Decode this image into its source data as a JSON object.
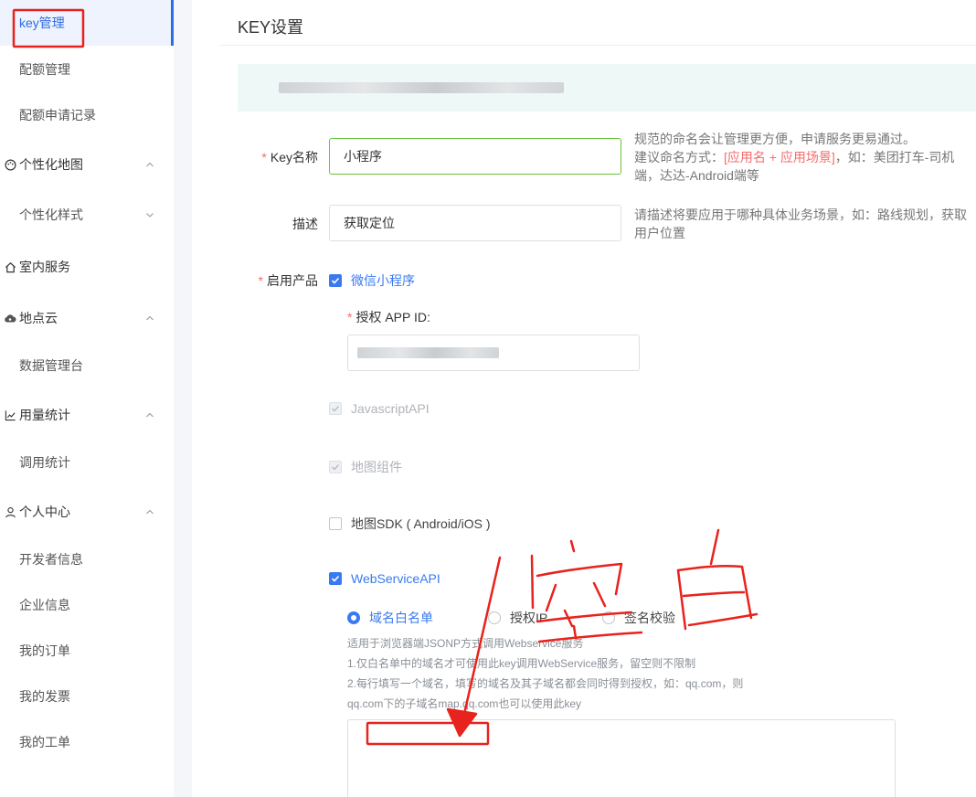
{
  "sidebar": {
    "items": [
      {
        "label": "key管理",
        "icon": "",
        "type": "sub",
        "active": true
      },
      {
        "label": "配额管理",
        "icon": "",
        "type": "sub"
      },
      {
        "label": "配额申请记录",
        "icon": "",
        "type": "sub"
      },
      {
        "label": "个性化地图",
        "icon": "palette-icon",
        "type": "group",
        "chevron": "up"
      },
      {
        "label": "个性化样式",
        "icon": "",
        "type": "sub",
        "chevron": "down"
      },
      {
        "label": "室内服务",
        "icon": "home-icon",
        "type": "group"
      },
      {
        "label": "地点云",
        "icon": "cloud-icon",
        "type": "group",
        "chevron": "up"
      },
      {
        "label": "数据管理台",
        "icon": "",
        "type": "sub"
      },
      {
        "label": "用量统计",
        "icon": "line-chart-icon",
        "type": "group",
        "chevron": "up"
      },
      {
        "label": "调用统计",
        "icon": "",
        "type": "sub"
      },
      {
        "label": "个人中心",
        "icon": "user-icon",
        "type": "group",
        "chevron": "up"
      },
      {
        "label": "开发者信息",
        "icon": "",
        "type": "sub"
      },
      {
        "label": "企业信息",
        "icon": "",
        "type": "sub"
      },
      {
        "label": "我的订单",
        "icon": "",
        "type": "sub"
      },
      {
        "label": "我的发票",
        "icon": "",
        "type": "sub"
      },
      {
        "label": "我的工单",
        "icon": "",
        "type": "sub"
      }
    ]
  },
  "main": {
    "title": "KEY设置",
    "key_name": {
      "required_mark": "*",
      "label": "Key名称",
      "value": "小程序",
      "hint_prefix": "规范的命名会让管理更方便，申请服务更易通过。",
      "hint_mid": "建议命名方式：",
      "hint_red": "[应用名 + 应用场景]",
      "hint_suffix": "，如：美团打车-司机端，达达-Android端等"
    },
    "description": {
      "label": "描述",
      "value": "获取定位",
      "hint": "请描述将要应用于哪种具体业务场景，如：路线规划，获取用户位置"
    },
    "products": {
      "required_mark": "*",
      "label": "启用产品",
      "miniprogram": {
        "label": "微信小程序",
        "checked": true
      },
      "app_id": {
        "required_mark": "*",
        "label": "授权 APP ID:"
      },
      "js_api": {
        "label": "JavascriptAPI",
        "checked": true,
        "disabled": true
      },
      "map_component": {
        "label": "地图组件",
        "checked": true,
        "disabled": true
      },
      "map_sdk": {
        "label": "地图SDK ( Android/iOS )",
        "checked": false
      },
      "webservice": {
        "label": "WebServiceAPI",
        "checked": true
      }
    },
    "auth_modes": {
      "options": [
        "域名白名单",
        "授权IP",
        "签名校验"
      ],
      "selected": "域名白名单"
    },
    "whitelist_desc": [
      "适用于浏览器端JSONP方式调用Webservice服务",
      "1.仅白名单中的域名才可使用此key调用WebService服务，留空则不限制",
      "2.每行填写一个域名，填写的域名及其子域名都会同时得到授权，如：qq.com，则",
      "qq.com下的子域名map.qq.com也可以使用此key"
    ],
    "handwriting": "空白"
  },
  "colors": {
    "accent": "#3a7af0",
    "required": "#f56c6c",
    "annotation": "#e8221c"
  }
}
